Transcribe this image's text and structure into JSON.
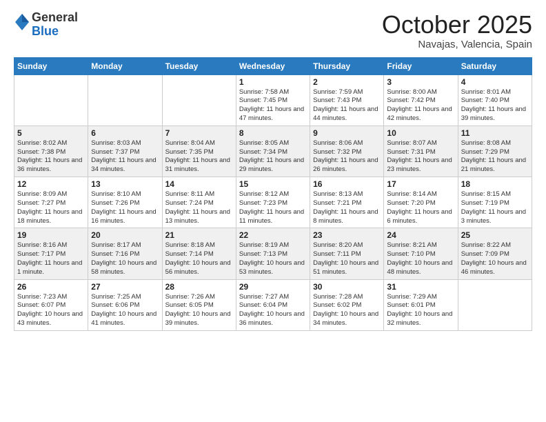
{
  "logo": {
    "general": "General",
    "blue": "Blue"
  },
  "header": {
    "month": "October 2025",
    "location": "Navajas, Valencia, Spain"
  },
  "weekdays": [
    "Sunday",
    "Monday",
    "Tuesday",
    "Wednesday",
    "Thursday",
    "Friday",
    "Saturday"
  ],
  "weeks": [
    [
      {
        "day": "",
        "info": ""
      },
      {
        "day": "",
        "info": ""
      },
      {
        "day": "",
        "info": ""
      },
      {
        "day": "1",
        "info": "Sunrise: 7:58 AM\nSunset: 7:45 PM\nDaylight: 11 hours and 47 minutes."
      },
      {
        "day": "2",
        "info": "Sunrise: 7:59 AM\nSunset: 7:43 PM\nDaylight: 11 hours and 44 minutes."
      },
      {
        "day": "3",
        "info": "Sunrise: 8:00 AM\nSunset: 7:42 PM\nDaylight: 11 hours and 42 minutes."
      },
      {
        "day": "4",
        "info": "Sunrise: 8:01 AM\nSunset: 7:40 PM\nDaylight: 11 hours and 39 minutes."
      }
    ],
    [
      {
        "day": "5",
        "info": "Sunrise: 8:02 AM\nSunset: 7:38 PM\nDaylight: 11 hours and 36 minutes."
      },
      {
        "day": "6",
        "info": "Sunrise: 8:03 AM\nSunset: 7:37 PM\nDaylight: 11 hours and 34 minutes."
      },
      {
        "day": "7",
        "info": "Sunrise: 8:04 AM\nSunset: 7:35 PM\nDaylight: 11 hours and 31 minutes."
      },
      {
        "day": "8",
        "info": "Sunrise: 8:05 AM\nSunset: 7:34 PM\nDaylight: 11 hours and 29 minutes."
      },
      {
        "day": "9",
        "info": "Sunrise: 8:06 AM\nSunset: 7:32 PM\nDaylight: 11 hours and 26 minutes."
      },
      {
        "day": "10",
        "info": "Sunrise: 8:07 AM\nSunset: 7:31 PM\nDaylight: 11 hours and 23 minutes."
      },
      {
        "day": "11",
        "info": "Sunrise: 8:08 AM\nSunset: 7:29 PM\nDaylight: 11 hours and 21 minutes."
      }
    ],
    [
      {
        "day": "12",
        "info": "Sunrise: 8:09 AM\nSunset: 7:27 PM\nDaylight: 11 hours and 18 minutes."
      },
      {
        "day": "13",
        "info": "Sunrise: 8:10 AM\nSunset: 7:26 PM\nDaylight: 11 hours and 16 minutes."
      },
      {
        "day": "14",
        "info": "Sunrise: 8:11 AM\nSunset: 7:24 PM\nDaylight: 11 hours and 13 minutes."
      },
      {
        "day": "15",
        "info": "Sunrise: 8:12 AM\nSunset: 7:23 PM\nDaylight: 11 hours and 11 minutes."
      },
      {
        "day": "16",
        "info": "Sunrise: 8:13 AM\nSunset: 7:21 PM\nDaylight: 11 hours and 8 minutes."
      },
      {
        "day": "17",
        "info": "Sunrise: 8:14 AM\nSunset: 7:20 PM\nDaylight: 11 hours and 6 minutes."
      },
      {
        "day": "18",
        "info": "Sunrise: 8:15 AM\nSunset: 7:19 PM\nDaylight: 11 hours and 3 minutes."
      }
    ],
    [
      {
        "day": "19",
        "info": "Sunrise: 8:16 AM\nSunset: 7:17 PM\nDaylight: 11 hours and 1 minute."
      },
      {
        "day": "20",
        "info": "Sunrise: 8:17 AM\nSunset: 7:16 PM\nDaylight: 10 hours and 58 minutes."
      },
      {
        "day": "21",
        "info": "Sunrise: 8:18 AM\nSunset: 7:14 PM\nDaylight: 10 hours and 56 minutes."
      },
      {
        "day": "22",
        "info": "Sunrise: 8:19 AM\nSunset: 7:13 PM\nDaylight: 10 hours and 53 minutes."
      },
      {
        "day": "23",
        "info": "Sunrise: 8:20 AM\nSunset: 7:11 PM\nDaylight: 10 hours and 51 minutes."
      },
      {
        "day": "24",
        "info": "Sunrise: 8:21 AM\nSunset: 7:10 PM\nDaylight: 10 hours and 48 minutes."
      },
      {
        "day": "25",
        "info": "Sunrise: 8:22 AM\nSunset: 7:09 PM\nDaylight: 10 hours and 46 minutes."
      }
    ],
    [
      {
        "day": "26",
        "info": "Sunrise: 7:23 AM\nSunset: 6:07 PM\nDaylight: 10 hours and 43 minutes."
      },
      {
        "day": "27",
        "info": "Sunrise: 7:25 AM\nSunset: 6:06 PM\nDaylight: 10 hours and 41 minutes."
      },
      {
        "day": "28",
        "info": "Sunrise: 7:26 AM\nSunset: 6:05 PM\nDaylight: 10 hours and 39 minutes."
      },
      {
        "day": "29",
        "info": "Sunrise: 7:27 AM\nSunset: 6:04 PM\nDaylight: 10 hours and 36 minutes."
      },
      {
        "day": "30",
        "info": "Sunrise: 7:28 AM\nSunset: 6:02 PM\nDaylight: 10 hours and 34 minutes."
      },
      {
        "day": "31",
        "info": "Sunrise: 7:29 AM\nSunset: 6:01 PM\nDaylight: 10 hours and 32 minutes."
      },
      {
        "day": "",
        "info": ""
      }
    ]
  ]
}
